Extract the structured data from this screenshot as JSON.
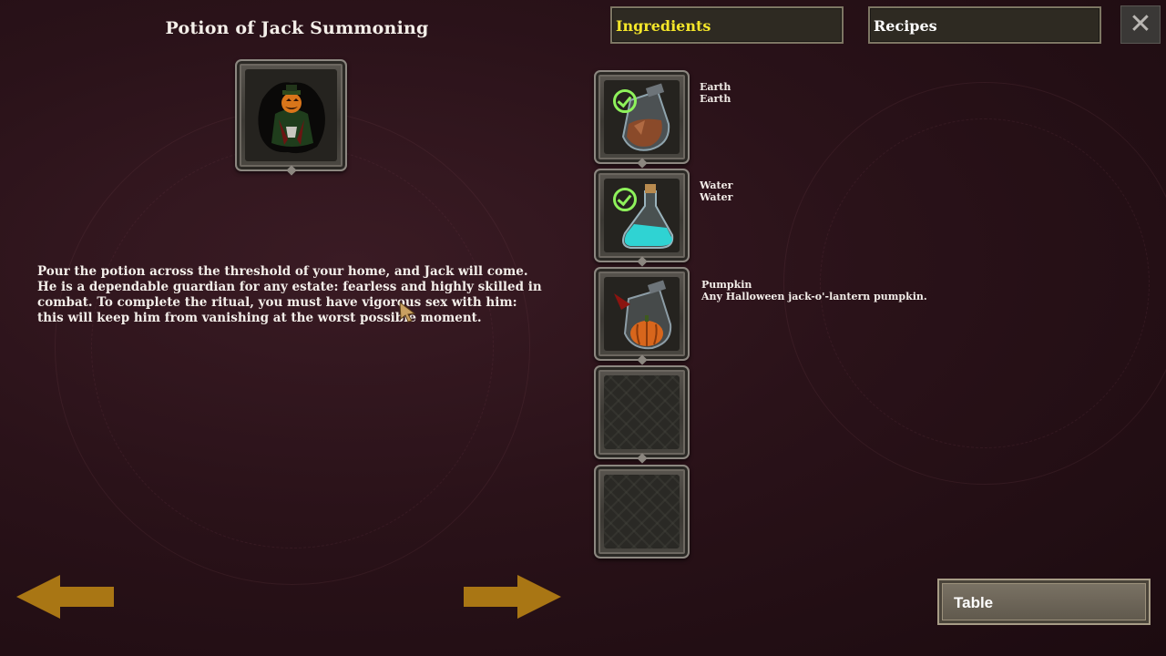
{
  "recipe": {
    "title": "Potion of Jack Summoning",
    "description": "Pour the potion across the threshold of your home, and Jack will come. He is a dependable guardian for any estate: fearless and highly skilled in combat. To complete the ritual, you must have vigorous sex with him: this will keep him from vanishing at the worst possible moment.",
    "portrait_icon": "jack-o-lantern-figure-icon"
  },
  "tabs": {
    "ingredients": "Ingredients",
    "recipes": "Recipes"
  },
  "close_icon": "close-icon",
  "ingredients": [
    {
      "name": "Earth",
      "detail": "Earth",
      "icon": "earth-jar-icon",
      "checked": true
    },
    {
      "name": "Water",
      "detail": "Water",
      "icon": "water-flask-icon",
      "checked": true
    },
    {
      "name": "Pumpkin",
      "detail": "Any Halloween jack-o'-lantern pumpkin.",
      "icon": "pumpkin-jar-icon",
      "checked": false
    }
  ],
  "buttons": {
    "table": "Table",
    "prev_icon": "arrow-left-icon",
    "next_icon": "arrow-right-icon"
  },
  "colors": {
    "active_tab": "#f4e62a",
    "check": "#8ef25b",
    "arrow": "#a97614"
  }
}
